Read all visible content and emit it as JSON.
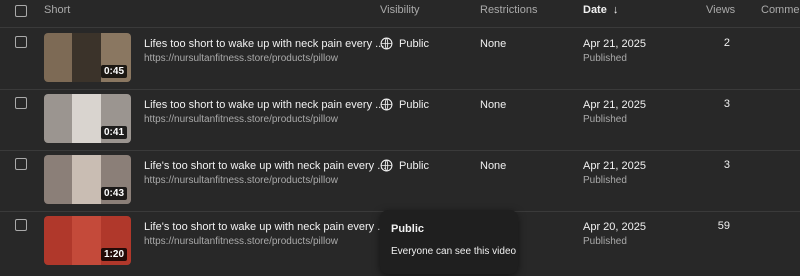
{
  "header": {
    "short": "Short",
    "visibility": "Visibility",
    "restrictions": "Restrictions",
    "date": "Date",
    "views": "Views",
    "comments": "Comment"
  },
  "rows": [
    {
      "title": "Lifes too short to wake up with neck pain every ...",
      "url": "https://nursultanfitness.store/products/pillow",
      "duration": "0:45",
      "visibility": "Public",
      "restrictions": "None",
      "date": "Apr 21, 2025",
      "status": "Published",
      "views": "2",
      "thumb_colors": [
        "#7d6a55",
        "#3b332a",
        "#8a7761"
      ]
    },
    {
      "title": "Lifes too short to wake up with neck pain every ...",
      "url": "https://nursultanfitness.store/products/pillow",
      "duration": "0:41",
      "visibility": "Public",
      "restrictions": "None",
      "date": "Apr 21, 2025",
      "status": "Published",
      "views": "3",
      "thumb_colors": [
        "#9b9590",
        "#d9d4cf",
        "#9b9590"
      ]
    },
    {
      "title": "Life's too short to wake up with neck pain every ...",
      "url": "https://nursultanfitness.store/products/pillow",
      "duration": "0:43",
      "visibility": "Public",
      "restrictions": "None",
      "date": "Apr 21, 2025",
      "status": "Published",
      "views": "3",
      "thumb_colors": [
        "#8b7f78",
        "#c9bdb3",
        "#8b7f78"
      ]
    },
    {
      "title": "Life's too short to wake up with neck pain every ...",
      "url": "https://nursultanfitness.store/products/pillow",
      "duration": "1:20",
      "visibility": "",
      "restrictions": "",
      "date": "Apr 20, 2025",
      "status": "Published",
      "views": "59",
      "thumb_colors": [
        "#b0382b",
        "#c44a3a",
        "#b0382b"
      ]
    }
  ],
  "tooltip": {
    "title": "Public",
    "description": "Everyone can see this video"
  }
}
